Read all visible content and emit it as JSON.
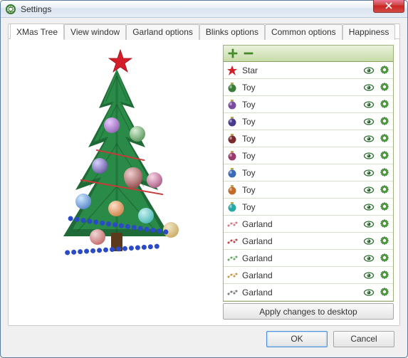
{
  "window": {
    "title": "Settings"
  },
  "tabs": [
    {
      "label": "XMas Tree"
    },
    {
      "label": "View window"
    },
    {
      "label": "Garland options"
    },
    {
      "label": "Blinks options"
    },
    {
      "label": "Common options"
    },
    {
      "label": "Happiness"
    }
  ],
  "active_tab": 0,
  "ornaments": [
    {
      "label": "Star",
      "kind": "star",
      "color": "#d41f2a"
    },
    {
      "label": "Toy",
      "kind": "bauble",
      "color": "#3a7d3a"
    },
    {
      "label": "Toy",
      "kind": "bauble",
      "color": "#7a4aa0"
    },
    {
      "label": "Toy",
      "kind": "bauble",
      "color": "#4a3a8a"
    },
    {
      "label": "Toy",
      "kind": "bauble",
      "color": "#7a2a2a"
    },
    {
      "label": "Toy",
      "kind": "bauble",
      "color": "#9a3a6a"
    },
    {
      "label": "Toy",
      "kind": "bauble",
      "color": "#3a6ab8"
    },
    {
      "label": "Toy",
      "kind": "bauble",
      "color": "#c26a2a"
    },
    {
      "label": "Toy",
      "kind": "bauble",
      "color": "#2aa8a8"
    },
    {
      "label": "Garland",
      "kind": "garland",
      "color": "#d47a8a"
    },
    {
      "label": "Garland",
      "kind": "garland",
      "color": "#b84a4a"
    },
    {
      "label": "Garland",
      "kind": "garland",
      "color": "#6aa86a"
    },
    {
      "label": "Garland",
      "kind": "garland",
      "color": "#c29a4a"
    },
    {
      "label": "Garland",
      "kind": "garland",
      "color": "#7a7a7a"
    }
  ],
  "buttons": {
    "apply": "Apply changes to desktop",
    "ok": "OK",
    "cancel": "Cancel"
  },
  "colors": {
    "tree_green": "#1a7a3a",
    "tree_dark": "#0d4d22",
    "accent_green": "#5a9c2a"
  }
}
